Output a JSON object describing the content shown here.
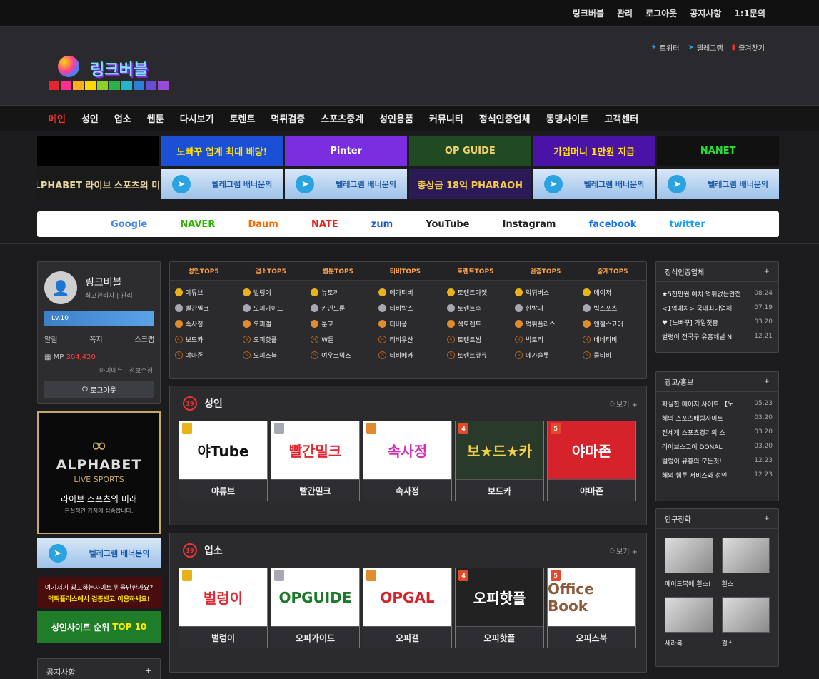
{
  "topbar": {
    "links": [
      "링크버블",
      "관리",
      "로그아웃",
      "공지사항",
      "1:1문의"
    ]
  },
  "logo": {
    "text": "링크버블",
    "bar_colors": [
      "#e3262f",
      "#ff2d8c",
      "#ffad1e",
      "#ffd700",
      "#8ad22b",
      "#2bb24a",
      "#23b5c9",
      "#2d7fd8",
      "#6a4bd6",
      "#9a4bd6"
    ]
  },
  "social": {
    "twitter": "트위터",
    "telegram": "텔레그램",
    "bookmark": "즐겨찾기"
  },
  "nav": [
    "메인",
    "성인",
    "업소",
    "웹툰",
    "다시보기",
    "토렌트",
    "먹튀검증",
    "스포츠중계",
    "성인용품",
    "커뮤니티",
    "정식인증업체",
    "동맹사이트",
    "고객센터"
  ],
  "banners": {
    "row1": [
      {
        "text": "",
        "bg": "#000000",
        "fg": "#ffffff"
      },
      {
        "text": "노빠꾸 업계 최대 배당!",
        "bg": "#1b4fd6",
        "fg": "#ffe200"
      },
      {
        "text": "Pinter",
        "bg": "#7b2de0",
        "fg": "#ffffff"
      },
      {
        "text": "OP GUIDE",
        "bg": "#1f4a22",
        "fg": "#f2d36b"
      },
      {
        "text": "가입머니 1만원 지급",
        "bg": "#4b12a8",
        "fg": "#ffe200"
      },
      {
        "text": "NANET",
        "bg": "#111111",
        "fg": "#28e03a"
      }
    ],
    "row2": [
      {
        "text": "ALPHABET 라이브 스포츠의 미래",
        "bg": "#1a1a1a",
        "fg": "#e6d3a3"
      },
      {
        "text": "텔레그램 배너문의",
        "type": "tg"
      },
      {
        "text": "텔레그램 배너문의",
        "type": "tg"
      },
      {
        "text": "총상금 18억 PHARAOH",
        "bg": "#2a1a55",
        "fg": "#f2c94c"
      },
      {
        "text": "텔레그램 배너문의",
        "type": "tg"
      },
      {
        "text": "텔레그램 배너문의",
        "type": "tg"
      }
    ],
    "tg_click": "CLICK"
  },
  "search_engines": [
    {
      "name": "Google",
      "color": "#4285f4"
    },
    {
      "name": "NAVER",
      "color": "#2db400"
    },
    {
      "name": "Daum",
      "color": "#ff6a00"
    },
    {
      "name": "NATE",
      "color": "#e2231a"
    },
    {
      "name": "zum",
      "color": "#1a5bd6"
    },
    {
      "name": "YouTube",
      "color": "#222222"
    },
    {
      "name": "Instagram",
      "color": "#222222"
    },
    {
      "name": "facebook",
      "color": "#1877f2"
    },
    {
      "name": "twitter",
      "color": "#1da1f2"
    }
  ],
  "profile": {
    "name": "링크버블",
    "role": "최고관리자 | 관리",
    "level": "Lv.10",
    "links": [
      "알림",
      "쪽지",
      "스크랩"
    ],
    "mp_label": "MP",
    "mp_value": "304,420",
    "menu": "마이메뉴 | 정보수정",
    "logout": "로그아웃"
  },
  "side_ad": {
    "brand": "ALPHABET",
    "sub": "LIVE SPORTS",
    "kr": "라이브 스포츠의 미래",
    "kr2": "본질적인 가치에 집중합니다."
  },
  "side_tg": "텔레그램 배너문의",
  "side_text1": {
    "line1": "여기저기 광고하는사이트 믿을만한가요?",
    "line2": "먹튀폴리스에서 검증받고 이용하세요!"
  },
  "side_text2": {
    "a": "성인사이트 순위",
    "b": "TOP 10"
  },
  "notice": {
    "title": "공지사항",
    "plus": "+"
  },
  "tops": {
    "tabs": [
      "성인TOP5",
      "업소TOP5",
      "웹툰TOP5",
      "티비TOP5",
      "토렌트TOP5",
      "검증TOP5",
      "중계TOP5"
    ],
    "columns": [
      [
        "야튜브",
        "빨간밀크",
        "속사정",
        "보드카",
        "야마존"
      ],
      [
        "벌렁이",
        "오피가이드",
        "오피갤",
        "오피핫플",
        "오피스북"
      ],
      [
        "뉴토끼",
        "카인드툰",
        "툰코",
        "W툰",
        "여우코믹스"
      ],
      [
        "메가티비",
        "티비박스",
        "티비퐁",
        "티비우산",
        "티비메카"
      ],
      [
        "토렌트마켓",
        "토렌트후",
        "섹토렌트",
        "토렌트썸",
        "토렌트큐큐"
      ],
      [
        "먹튀버스",
        "한방대",
        "먹튀폴리스",
        "빅토리",
        "메가슬롯"
      ],
      [
        "메이저",
        "빅스포츠",
        "엔젤스코어",
        "네네티비",
        "쿨티비"
      ]
    ]
  },
  "sections": [
    {
      "title": "성인",
      "more": "더보기 +",
      "badge": "19",
      "cards": [
        {
          "label": "야튜브",
          "img": "야Tube",
          "fg": "#111111",
          "bg": "#ffffff",
          "rank": ""
        },
        {
          "label": "빨간밀크",
          "img": "빨간밀크",
          "fg": "#e3262f",
          "bg": "#ffffff",
          "rank": ""
        },
        {
          "label": "속사정",
          "img": "속사정",
          "fg": "#d62ab8",
          "bg": "#ffffff",
          "rank": ""
        },
        {
          "label": "보드카",
          "img": "보★드★카",
          "fg": "#f4d046",
          "bg": "#2a3a2a",
          "rank": "4"
        },
        {
          "label": "야마존",
          "img": "야마존",
          "fg": "#ffffff",
          "bg": "#d6222a",
          "rank": "5"
        }
      ]
    },
    {
      "title": "업소",
      "more": "더보기 +",
      "badge": "19",
      "cards": [
        {
          "label": "벌렁이",
          "img": "벌렁이",
          "fg": "#e3262f",
          "bg": "#ffffff",
          "rank": ""
        },
        {
          "label": "오피가이드",
          "img": "OPGUIDE",
          "fg": "#1a7a2a",
          "bg": "#ffffff",
          "rank": ""
        },
        {
          "label": "오피갤",
          "img": "OPGAL",
          "fg": "#d6222a",
          "bg": "#ffffff",
          "rank": ""
        },
        {
          "label": "오피핫플",
          "img": "오피핫플",
          "fg": "#ffffff",
          "bg": "#222222",
          "rank": "4"
        },
        {
          "label": "오피스북",
          "img": "Office Book",
          "fg": "#8a5a3a",
          "bg": "#ffffff",
          "rank": "5"
        }
      ]
    }
  ],
  "right": {
    "verified": {
      "title": "정식인증업체",
      "plus": "+",
      "items": [
        {
          "text": "★5천만원 예치 먹튀없는안전",
          "date": "08.24"
        },
        {
          "text": "<1억예치> 국내최대업체",
          "date": "07.19"
        },
        {
          "text": "♥ [노빠꾸] 가입첫충",
          "date": "03.20"
        },
        {
          "text": "벌렁이 전국구 유흥채널 N",
          "date": "12.21"
        }
      ]
    },
    "ads": {
      "title": "광고/홍보",
      "plus": "+",
      "items": [
        {
          "text": "확실한 메이저 사이트 【노",
          "date": "05.23"
        },
        {
          "text": "해외 스포츠배팅사이트",
          "date": "03.20"
        },
        {
          "text": "전세계 스포츠경기의 스",
          "date": "03.20"
        },
        {
          "text": "라이브스코어 DONAL",
          "date": "03.20"
        },
        {
          "text": "벌렁이 유흥의 모든것!",
          "date": "12.23"
        },
        {
          "text": "해외 웹툰 서비스와 성인",
          "date": "12.23"
        }
      ]
    },
    "gallery": {
      "title": "안구정화",
      "plus": "+",
      "items": [
        "메이드복에 흰스!",
        "흰스",
        "세라복",
        "검스"
      ]
    }
  }
}
